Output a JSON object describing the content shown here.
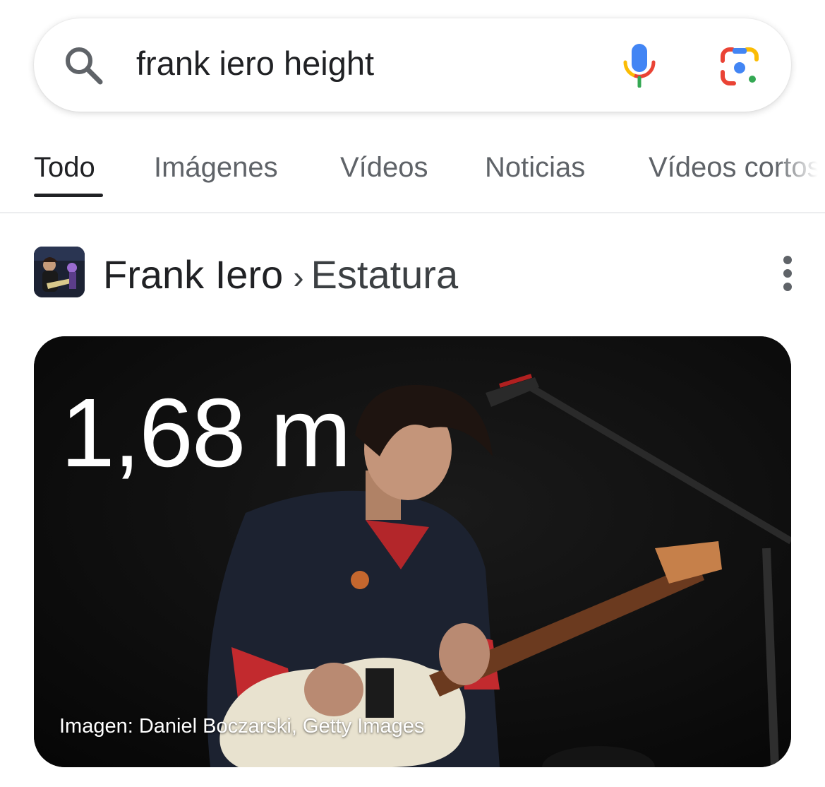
{
  "search": {
    "query": "frank iero height",
    "icons": {
      "left": "search-icon",
      "voice": "microphone-icon",
      "lens": "google-lens-icon"
    }
  },
  "tabs": [
    {
      "label": "Todo",
      "active": true
    },
    {
      "label": "Imágenes",
      "active": false
    },
    {
      "label": "Vídeos",
      "active": false
    },
    {
      "label": "Noticias",
      "active": false
    },
    {
      "label": "Vídeos cortos",
      "active": false
    }
  ],
  "breadcrumb": {
    "entity": "Frank Iero",
    "separator": "›",
    "attribute": "Estatura",
    "menu_icon": "more-vert-icon"
  },
  "answer_card": {
    "value": "1,68 m",
    "credit": "Imagen: Daniel Boczarski, Getty Images"
  },
  "colors": {
    "google_blue": "#4285F4",
    "google_red": "#EA4335",
    "google_yellow": "#FBBC04",
    "google_green": "#34A853",
    "text_primary": "#202124",
    "text_secondary": "#5f6368"
  }
}
